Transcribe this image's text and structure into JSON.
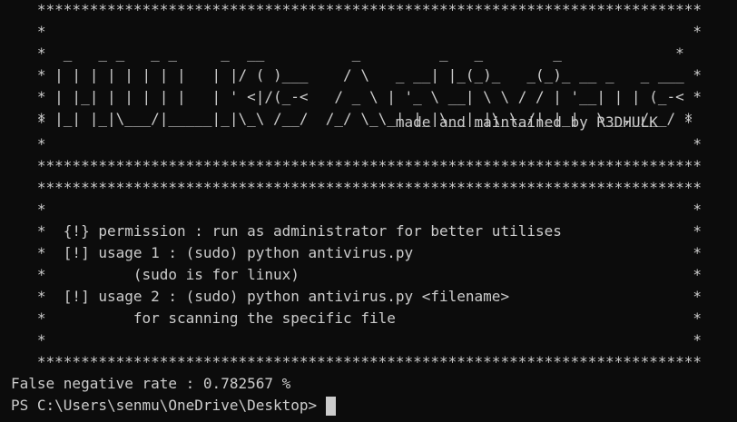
{
  "banner": {
    "lines": [
      "   ****************************************************************************",
      "   *                                                                          *",
      "   *  _   _ _   _ _     _  __          _         _   _        _             *",
      "   * | | | | | | | |   | |/ ( )___    / \\   _ __| |_(_)_   _(_)_ __ _   _ ___ *",
      "   * | |_| | | | | |   | ' <|/(_-<   / _ \\ | '_ \\ __| \\ \\ / / | '__| | | (_-< *",
      "   * |_| |_|\\___/|_____|_|\\_\\ /__/  /_/ \\_\\_| |_|\\__|_|\\_\\_/|_|_|  \\__,_/__/ *",
      "   *                                        made and maintained by R3DHULK   *",
      "   *                                                                          *",
      "   ****************************************************************************",
      "   ****************************************************************************",
      "   *                                                                          *",
      "   *  {!} permission : run as administrator for better utilises               *",
      "   *  [!] usage 1 : (sudo) python antivirus.py                                *",
      "   *          (sudo is for linux)                                             *",
      "   *  [!] usage 2 : (sudo) python antivirus.py <filename>                     *",
      "   *          for scanning the specific file                                  *",
      "   *                                                                          *",
      "   ****************************************************************************"
    ]
  },
  "output": {
    "result": "False negative rate : 0.782567 %"
  },
  "prompt": {
    "text": "PS C:\\Users\\senmu\\OneDrive\\Desktop> "
  },
  "colors": {
    "background": "#0c0c0c",
    "foreground": "#cccccc"
  }
}
